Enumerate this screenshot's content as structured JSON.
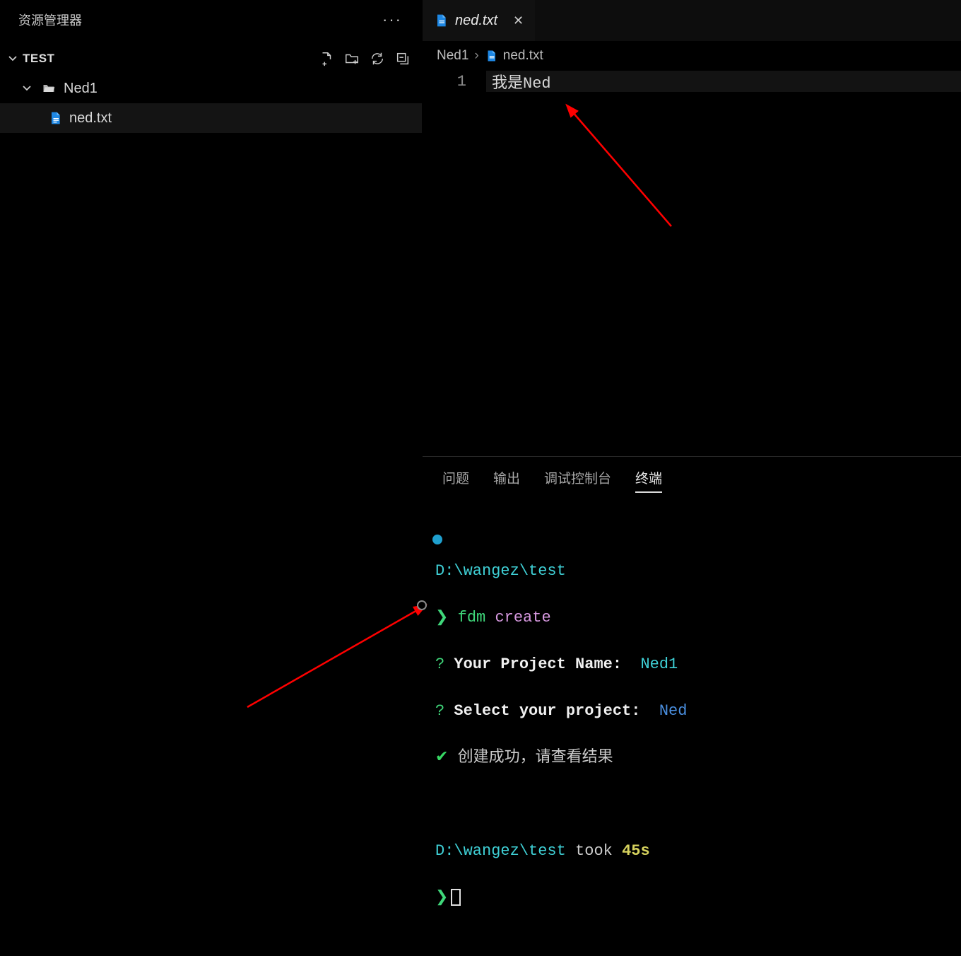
{
  "sidebar": {
    "title": "资源管理器",
    "section": "TEST",
    "folder": "Ned1",
    "file": "ned.txt"
  },
  "tab": {
    "name": "ned.txt"
  },
  "breadcrumb": {
    "folder": "Ned1",
    "file": "ned.txt"
  },
  "editor": {
    "lineNo": "1",
    "content": "我是Ned"
  },
  "panel": {
    "tabs": {
      "problems": "问题",
      "output": "输出",
      "debug": "调试控制台",
      "terminal": "终端"
    },
    "cwd": "D:\\wangez\\test",
    "cmd_prefix": "fdm",
    "cmd_rest": " create",
    "q1_label": "Your Project Name: ",
    "q1_answer": "Ned1",
    "q2_label": "Select your project: ",
    "q2_answer": "Ned",
    "success": "创建成功，请查看结果",
    "took_label": " took ",
    "took_value": "45s",
    "prompt": "❯"
  }
}
